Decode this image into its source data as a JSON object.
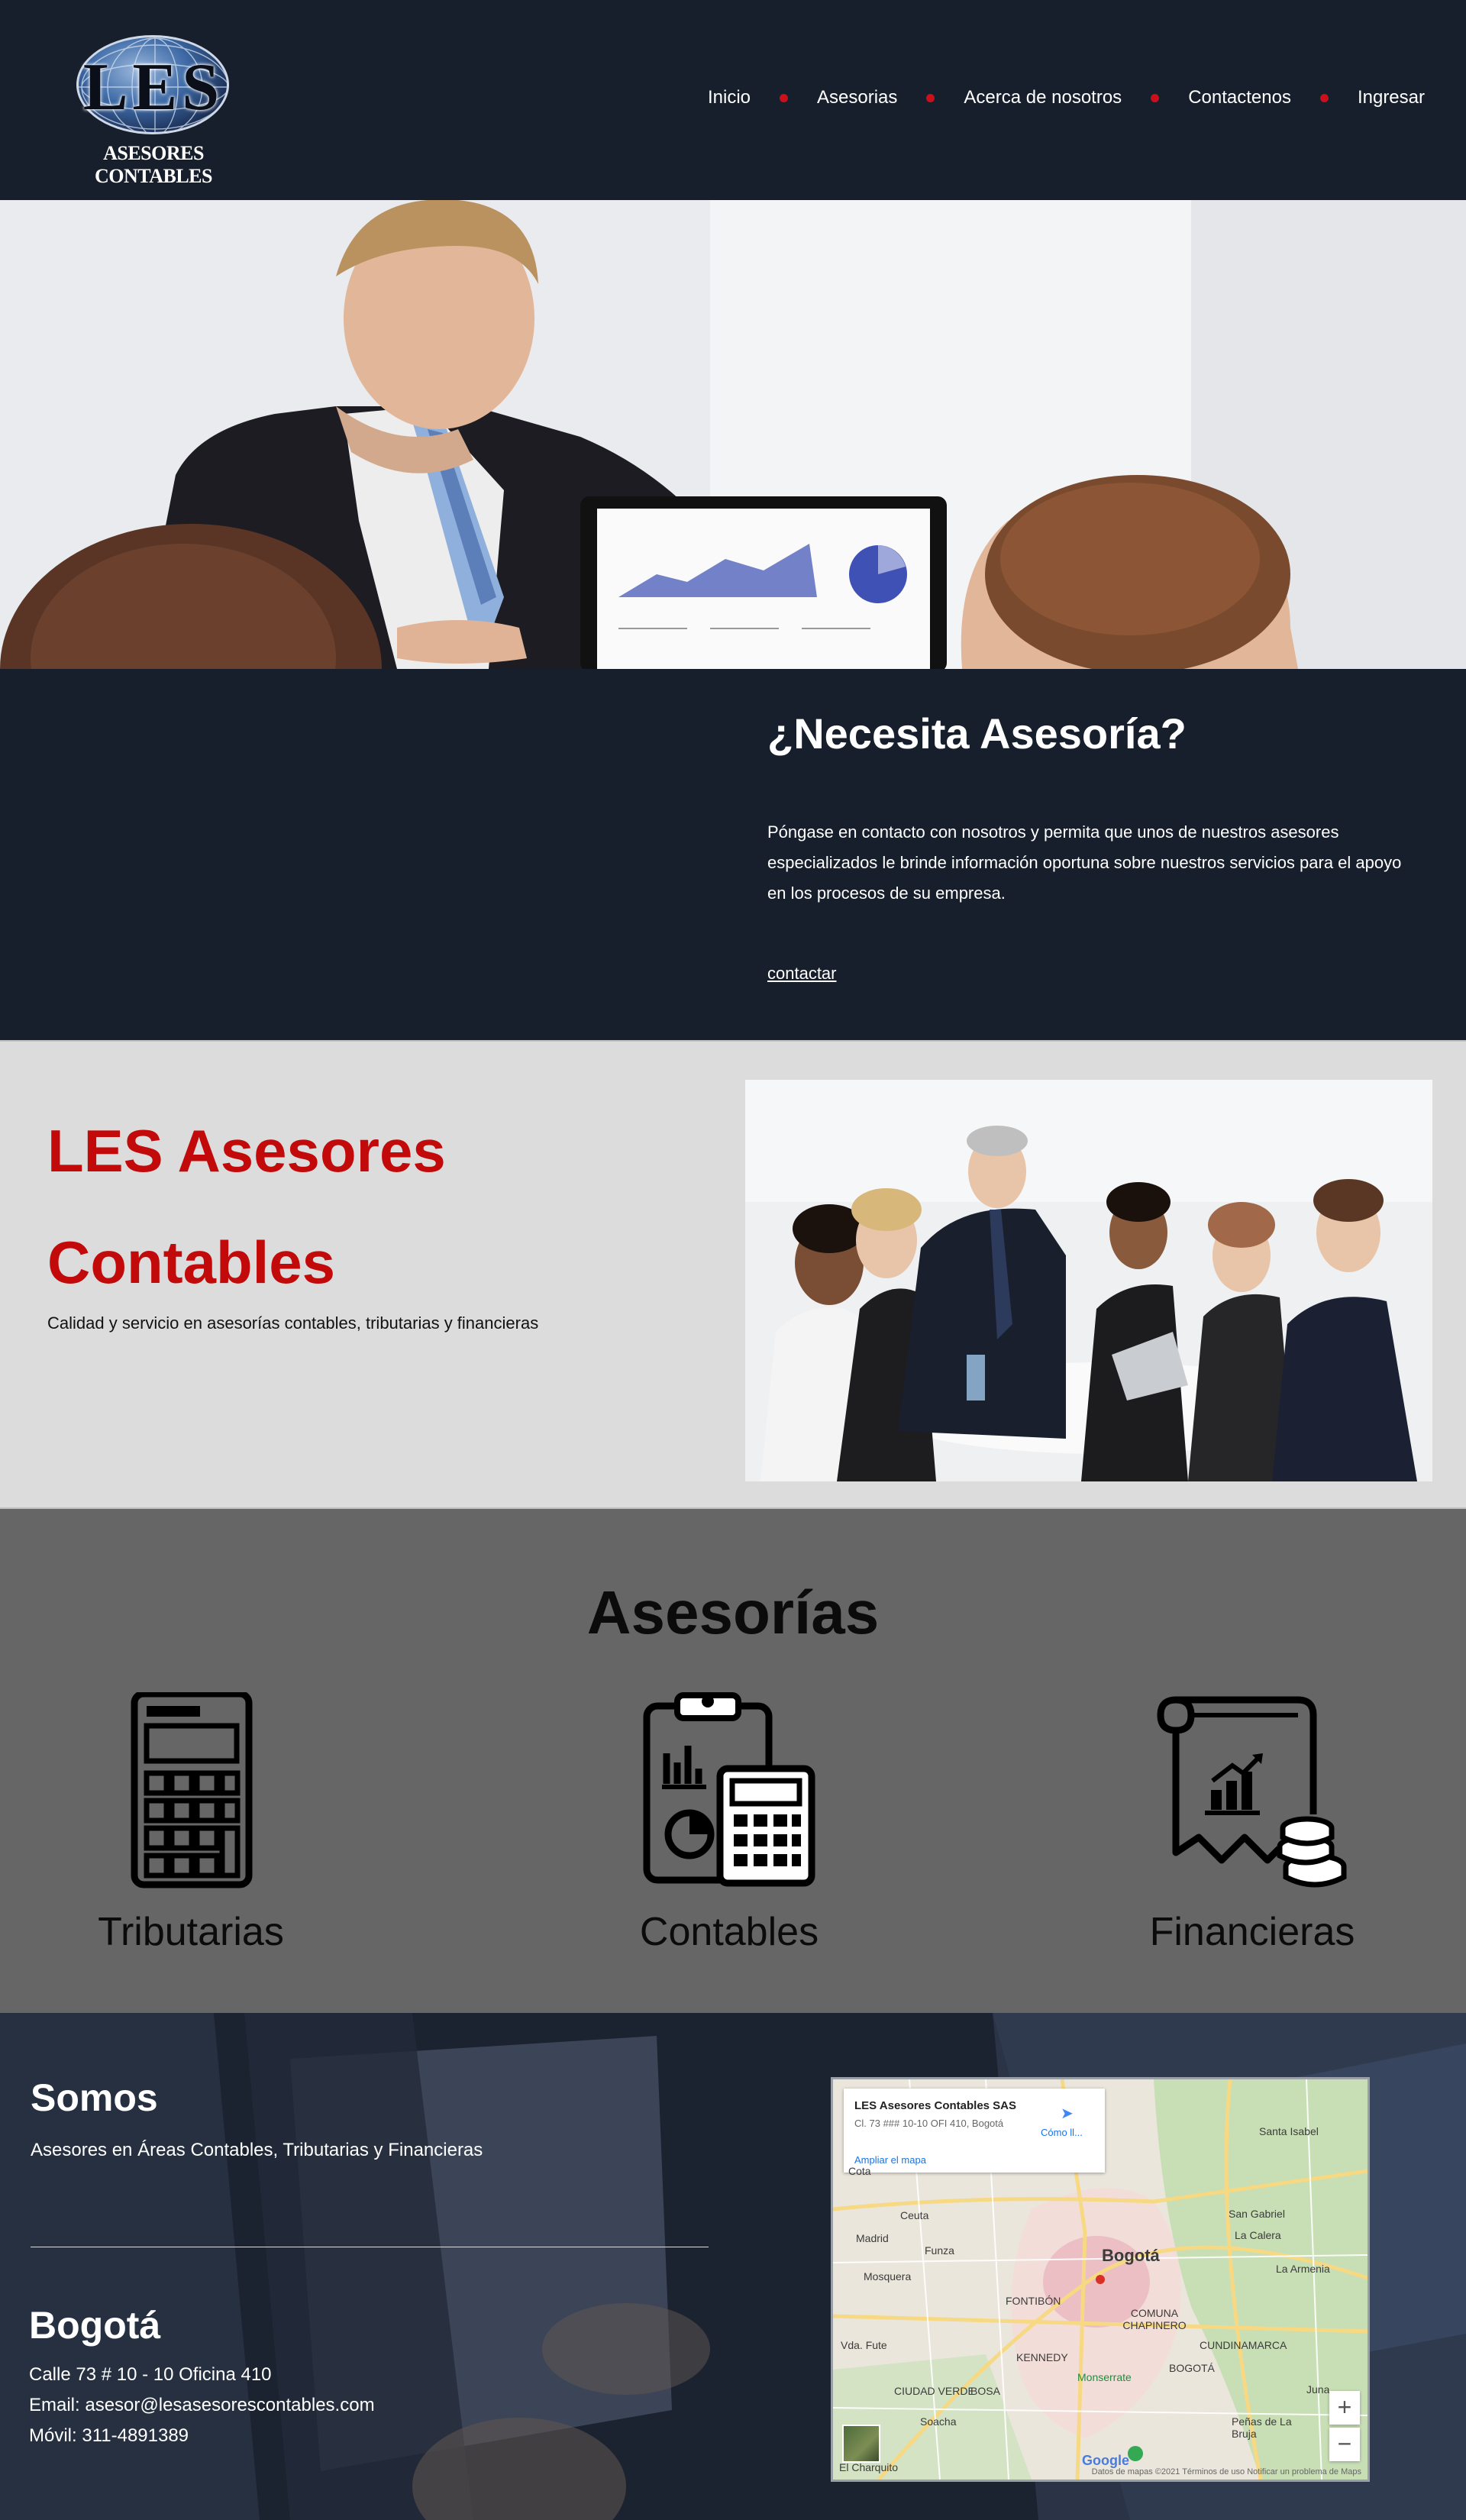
{
  "logo": {
    "main": "LES",
    "sub": "ASESORES CONTABLES"
  },
  "nav": {
    "items": [
      "Inicio",
      "Asesorias",
      "Acerca de nosotros",
      "Contactenos",
      "Ingresar"
    ]
  },
  "cta": {
    "title": "¿Necesita Asesoría?",
    "text": "Póngase en contacto con nosotros y permita que unos de nuestros asesores especializados le brinde información oportuna sobre nuestros servicios para el apoyo en los procesos de su empresa.",
    "link": "contactar"
  },
  "about": {
    "title": "LES Asesores Contables",
    "subtitle": "Calidad y servicio en asesorías contables, tributarias y financieras"
  },
  "services": {
    "title": "Asesorías",
    "items": [
      {
        "label": "Tributarias",
        "icon": "calculator-icon"
      },
      {
        "label": "Contables",
        "icon": "clipboard-calculator-icon"
      },
      {
        "label": "Financieras",
        "icon": "financial-report-coins-icon"
      }
    ]
  },
  "footer": {
    "somos_title": "Somos",
    "somos_text": "Asesores en Áreas Contables, Tributarias y Financieras",
    "city": "Bogotá",
    "address": "Calle 73 # 10 - 10 Oficina 410",
    "email": "Email: asesor@lesasesorescontables.com",
    "phone": "Móvil: 311-4891389"
  },
  "map": {
    "card_title": "LES Asesores Contables SAS",
    "card_address": "Cl. 73 ### 10-10 OFI 410, Bogotá",
    "card_directions": "Cómo ll...",
    "card_enlarge": "Ampliar el mapa",
    "city_label": "Bogotá",
    "places": [
      "Cota",
      "Madrid",
      "Funza",
      "Mosquera",
      "Ceuta",
      "Santa Isabel",
      "San Gabriel",
      "La Calera",
      "La Armenia",
      "FONTIBÓN",
      "COMUNA CHAPINERO",
      "KENNEDY",
      "Monserrate",
      "BOSA",
      "CIUDAD VERDE",
      "Soacha",
      "Vda. Fute",
      "Juna",
      "Peñas de La Bruja",
      "El Charquito",
      "CUNDINAMARCA",
      "BOGOTÁ"
    ],
    "google": "Google",
    "footer_text": "Datos de mapas ©2021   Términos de uso   Notificar un problema de Maps",
    "zoom_in": "+",
    "zoom_out": "−"
  },
  "colors": {
    "navy": "#171e2c",
    "accent_red": "#c20a0a",
    "nav_dot": "#cc0f18",
    "about_bg": "#dcdcdc",
    "services_bg": "#666666"
  }
}
